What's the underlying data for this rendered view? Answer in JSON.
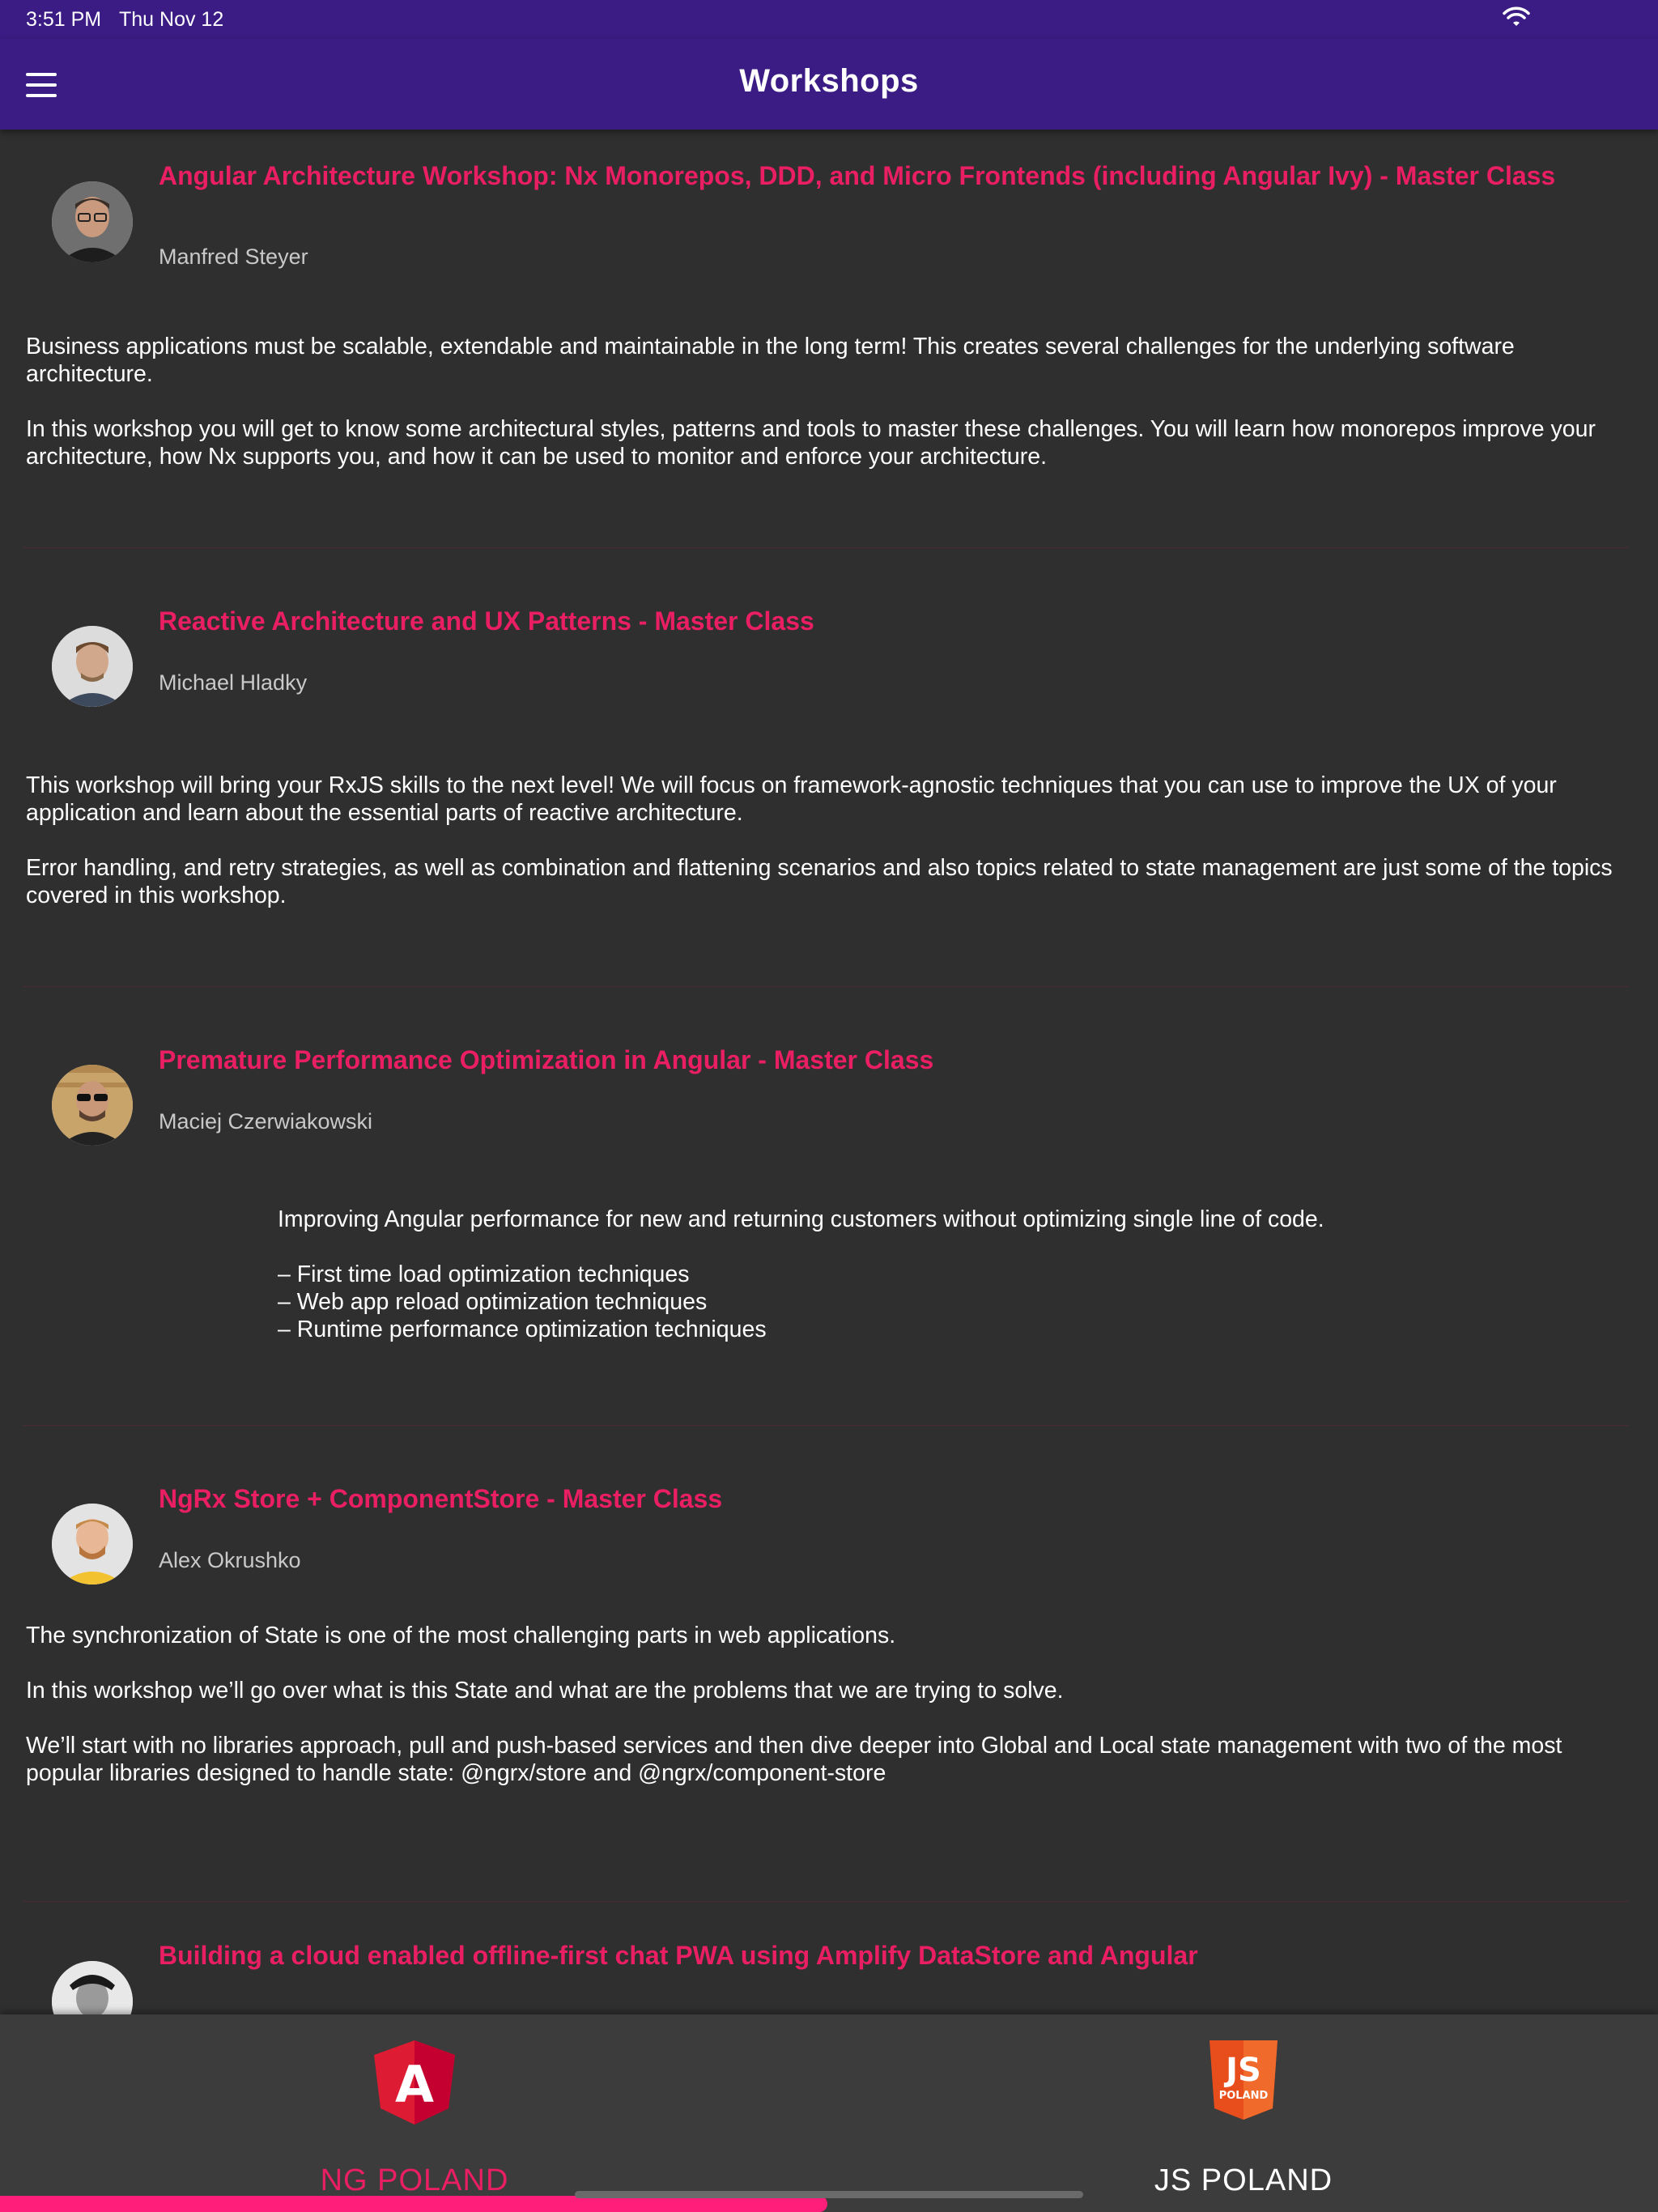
{
  "status_bar": {
    "time": "3:51 PM",
    "date": "Thu Nov 12"
  },
  "app_bar": {
    "title": "Workshops"
  },
  "workshops": [
    {
      "title": "Angular Architecture Workshop: Nx Monorepos, DDD, and Micro Frontends (including Angular Ivy) - Master Class",
      "speaker": "Manfred Steyer",
      "paragraphs": [
        "Business applications must be scalable, extendable and maintainable in the long term! This creates several challenges for the underlying software architecture.",
        "In this workshop you will get to know some architectural styles, patterns and tools to master these challenges. You will learn how monorepos improve your architecture, how Nx supports you, and how it can be used to monitor and enforce your architecture."
      ]
    },
    {
      "title": "Reactive Architecture and UX Patterns - Master Class",
      "speaker": "Michael Hladky",
      "paragraphs": [
        "This workshop will bring your RxJS skills to the next level! We will focus on framework-agnostic techniques that you can use to improve the UX of your application and learn about the essential parts of reactive architecture.",
        "Error handling, and retry strategies, as well as combination and flattening scenarios and also topics related to state management are just some of the topics covered in this workshop."
      ]
    },
    {
      "title": "Premature Performance Optimization in Angular - Master Class",
      "speaker": "Maciej Czerwiakowski",
      "intro": "Improving Angular performance for new and returning customers without optimizing single line of code.",
      "bullets": [
        "– First time load optimization techniques",
        "– Web app reload optimization techniques",
        "– Runtime performance optimization techniques"
      ]
    },
    {
      "title": "NgRx Store + ComponentStore - Master Class",
      "speaker": "Alex Okrushko",
      "paragraphs": [
        "The synchronization of State is one of the most challenging parts in web applications.",
        "In this workshop we’ll go over what is this State and what are the problems that we are trying to solve.",
        "We’ll start with no libraries approach, pull and push-based services and then dive deeper into Global and Local state management with two of the most popular libraries designed to handle state: @ngrx/store and @ngrx/component-store"
      ]
    },
    {
      "title": "Building a cloud enabled offline-first chat PWA using Amplify DataStore and Angular"
    }
  ],
  "bottom_nav": {
    "items": [
      {
        "label": "NG POLAND",
        "icon": "angular-logo-icon",
        "active": true
      },
      {
        "label": "JS POLAND",
        "icon": "js-poland-logo-icon",
        "active": false
      }
    ],
    "logo_text": {
      "angular": "A",
      "js": "JS",
      "js_sub": "POLAND"
    }
  },
  "colors": {
    "app_bar": "#3b1c85",
    "accent": "#e91e63",
    "background": "#2f2f2f",
    "bottom_nav": "#3c3c3c",
    "progress": "#ff1f7a"
  }
}
